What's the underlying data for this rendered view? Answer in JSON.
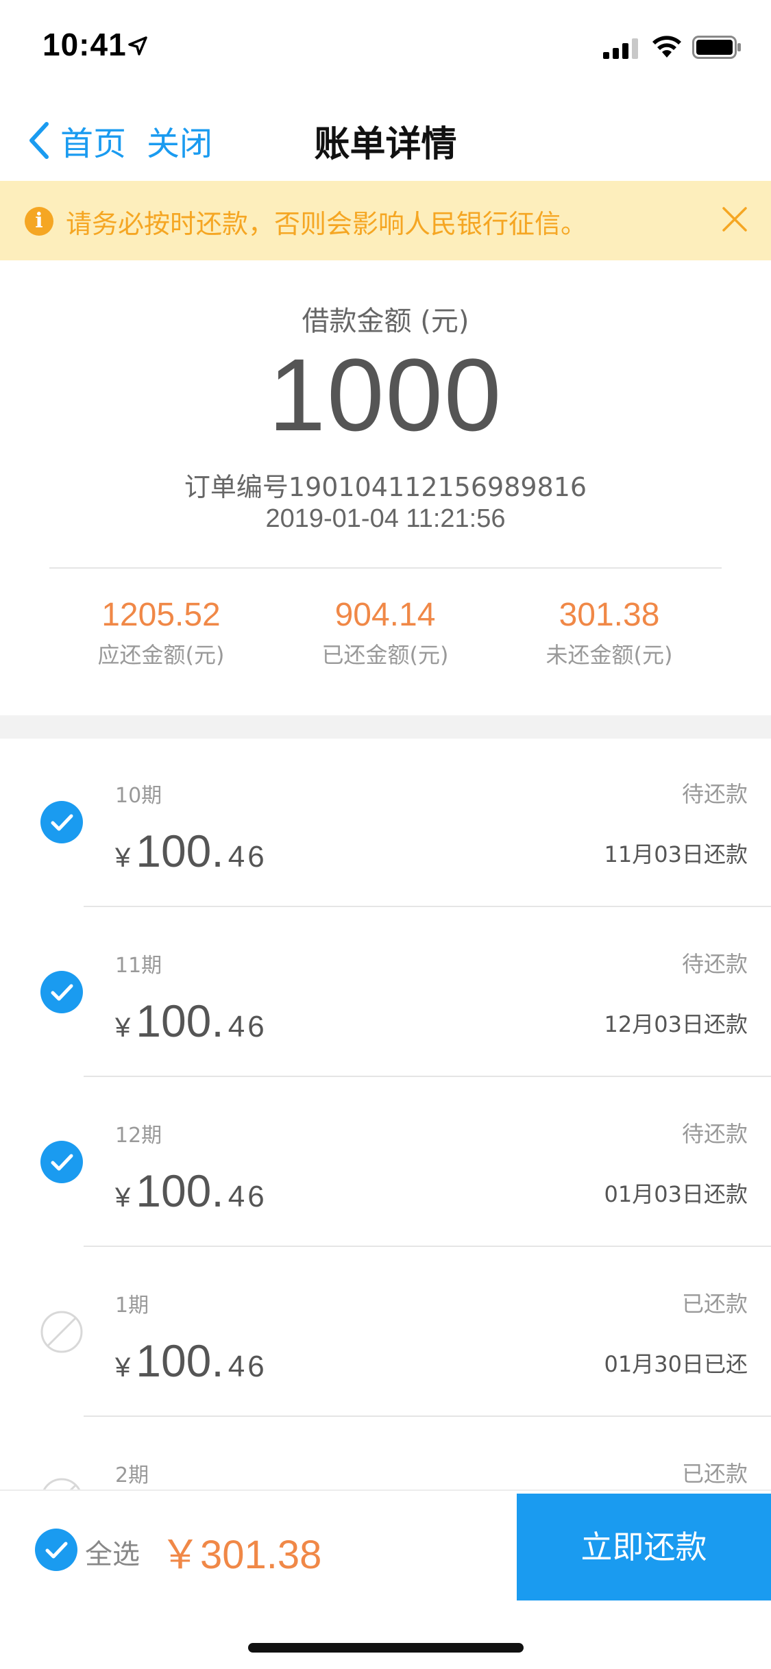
{
  "status_bar": {
    "time": "10:41"
  },
  "nav": {
    "back_label": "首页",
    "close_label": "关闭",
    "title": "账单详情"
  },
  "notice": {
    "icon": "i",
    "text": "请务必按时还款，否则会影响人民银行征信。"
  },
  "summary": {
    "loan_label": "借款金额 (元)",
    "loan_amount": "1000",
    "order_no": "订单编号19010411215698981​6",
    "order_time": "2019-01-04 11:21:56",
    "stats": [
      {
        "value": "1205.52",
        "label": "应还金额(元)"
      },
      {
        "value": "904.14",
        "label": "已还金额(元)"
      },
      {
        "value": "301.38",
        "label": "未还金额(元)"
      }
    ]
  },
  "installments": [
    {
      "period": "10期",
      "yen": "¥",
      "amount_int": "100.",
      "amount_dec": "46",
      "status": "待还款",
      "due": "11月03日还款",
      "checked": true
    },
    {
      "period": "11期",
      "yen": "¥",
      "amount_int": "100.",
      "amount_dec": "46",
      "status": "待还款",
      "due": "12月03日还款",
      "checked": true
    },
    {
      "period": "12期",
      "yen": "¥",
      "amount_int": "100.",
      "amount_dec": "46",
      "status": "待还款",
      "due": "01月03日还款",
      "checked": true
    },
    {
      "period": "1期",
      "yen": "¥",
      "amount_int": "100.",
      "amount_dec": "46",
      "status": "已还款",
      "due": "01月30日已还",
      "checked": false
    },
    {
      "period": "2期",
      "yen": "",
      "amount_int": "",
      "amount_dec": "",
      "status": "已还款",
      "due": "",
      "checked": false
    }
  ],
  "footer": {
    "select_all_label": "全选",
    "total": "￥301.38",
    "pay_label": "立即还款"
  },
  "colors": {
    "accent": "#1a9bf0",
    "orange": "#f08847",
    "notice_bg": "#fdeebc",
    "notice_text": "#f5a623"
  }
}
